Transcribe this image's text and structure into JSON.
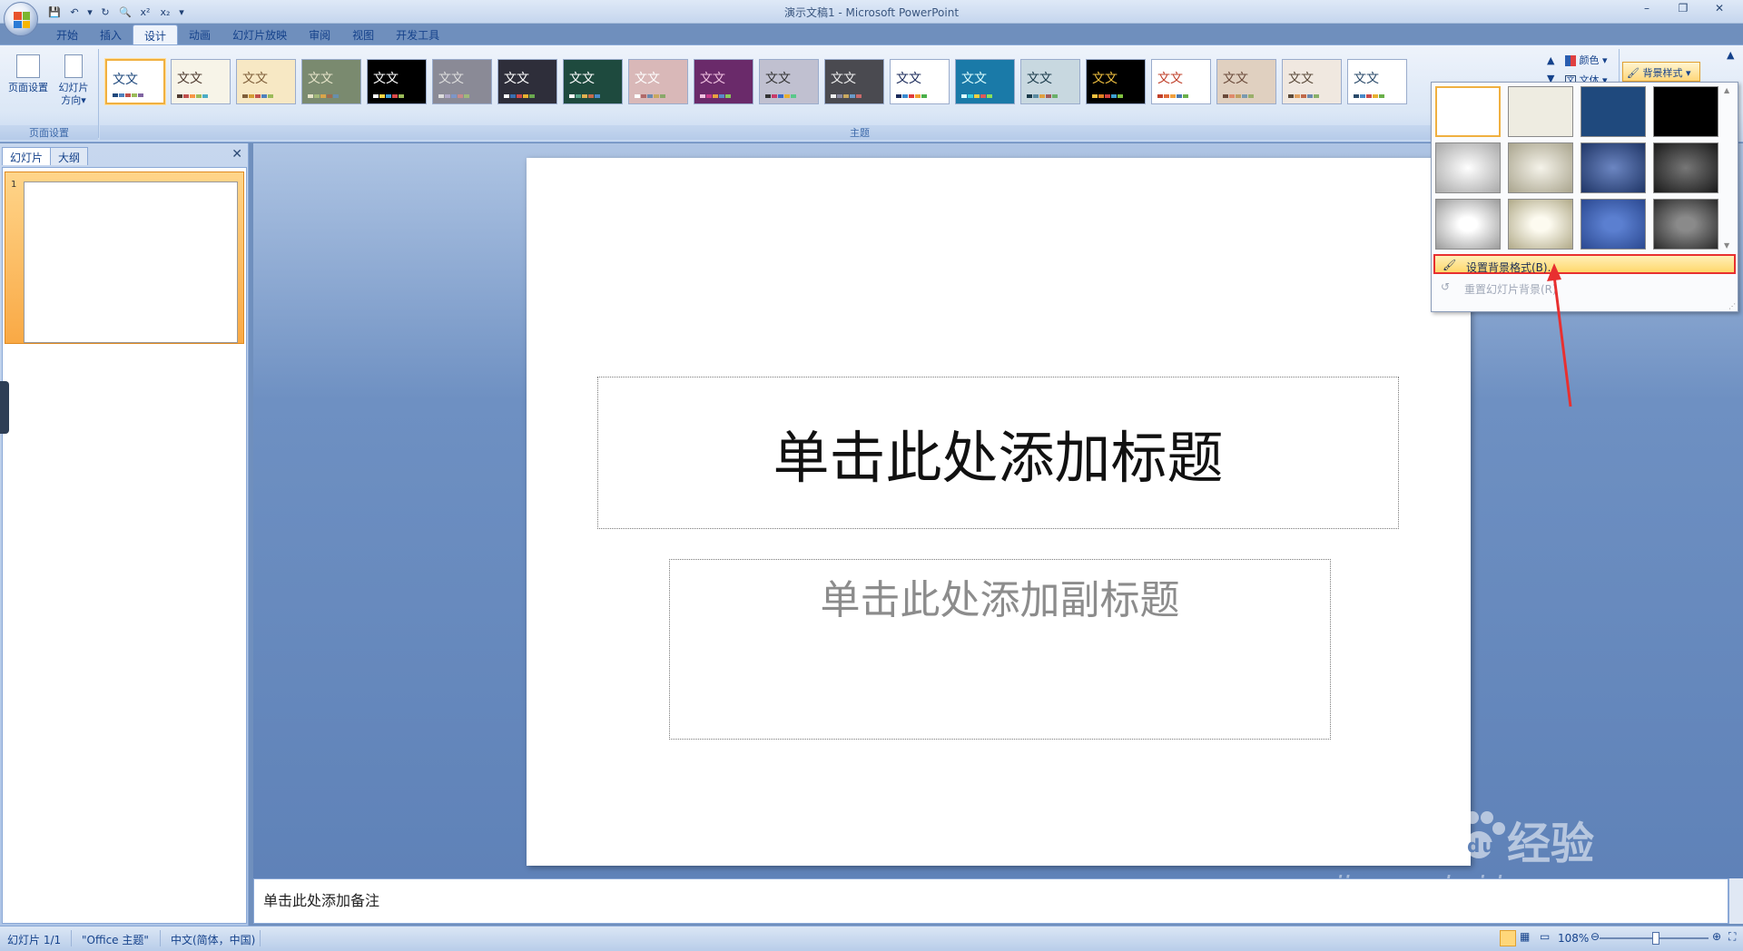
{
  "window": {
    "title": "演示文稿1 - Microsoft PowerPoint",
    "controls": [
      "minimize",
      "restore",
      "close"
    ]
  },
  "quick_access": [
    "save-icon",
    "undo-icon",
    "redo-icon",
    "print-preview-icon",
    "superscript-icon",
    "subscript-icon"
  ],
  "ribbon_tabs": [
    {
      "label": "开始",
      "active": false
    },
    {
      "label": "插入",
      "active": false
    },
    {
      "label": "设计",
      "active": true
    },
    {
      "label": "动画",
      "active": false
    },
    {
      "label": "幻灯片放映",
      "active": false
    },
    {
      "label": "审阅",
      "active": false
    },
    {
      "label": "视图",
      "active": false
    },
    {
      "label": "开发工具",
      "active": false
    }
  ],
  "ribbon": {
    "page_setup": {
      "page_setup_label": "页面设置",
      "orientation_label_1": "幻灯片",
      "orientation_label_2": "方向",
      "group_label": "页面设置"
    },
    "themes": {
      "group_label": "主题",
      "theme_text": "文文",
      "count": 22
    },
    "colors_label": "颜色",
    "fonts_label": "文体",
    "background_styles_label": "背景样式"
  },
  "left_panel": {
    "tabs": [
      "幻灯片",
      "大纲"
    ],
    "active_tab": "幻灯片",
    "slide_number": "1"
  },
  "slide": {
    "title_placeholder": "单击此处添加标题",
    "subtitle_placeholder": "单击此处添加副标题"
  },
  "notes": {
    "placeholder": "单击此处添加备注"
  },
  "background_menu": {
    "items": [
      {
        "label": "设置背景格式(B)...",
        "enabled": true,
        "highlighted": true
      },
      {
        "label": "重置幻灯片背景(R)",
        "enabled": false,
        "highlighted": false
      }
    ]
  },
  "watermark": {
    "logo": "Bai",
    "brand": "经验",
    "url": "jingyan.baidu.com"
  },
  "status_bar": {
    "slide_info": "幻灯片 1/1",
    "theme": "\"Office 主题\"",
    "language": "中文(简体，中国)",
    "zoom": "108%"
  },
  "colors": {
    "ribbon_bg": "#dbe7f6",
    "workspace_bg": "#6e90c2",
    "highlight": "#ffd86c",
    "annotation_red": "#e83030"
  }
}
